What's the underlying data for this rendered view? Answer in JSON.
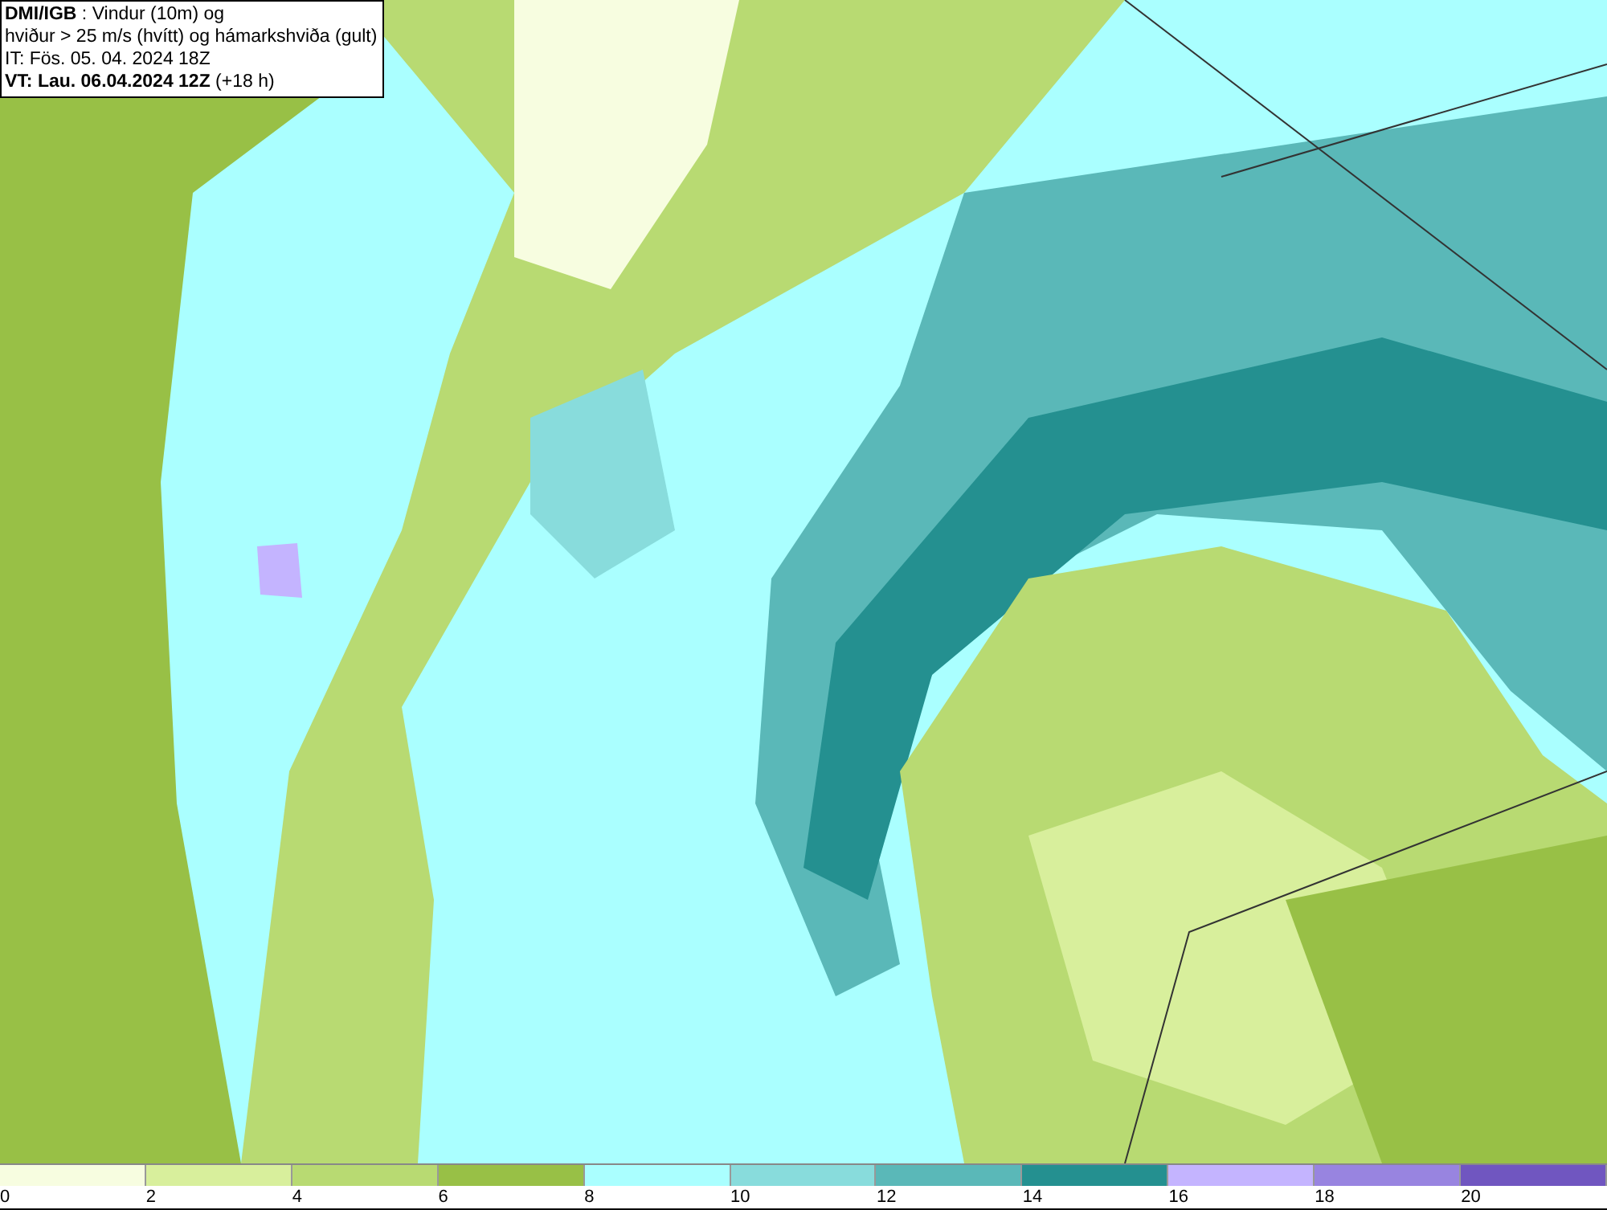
{
  "title_box": {
    "lines": [
      "**DMI/IGB** : Vindur (10m) og",
      "hviður > 25 m/s (hvítt) og hámarkshviða (gult)",
      "IT: Fös. 05. 04. 2024 18Z",
      "**VT: Lau. 06.04.2024 12Z** (+18 h)"
    ]
  },
  "legend": [
    {
      "label": "0",
      "color": "#f7fde0"
    },
    {
      "label": "2",
      "color": "#d8ef9c"
    },
    {
      "label": "4",
      "color": "#b8da72"
    },
    {
      "label": "6",
      "color": "#98c046"
    },
    {
      "label": "8",
      "color": "#aaffff"
    },
    {
      "label": "10",
      "color": "#88dcdc"
    },
    {
      "label": "12",
      "color": "#5ab8b8"
    },
    {
      "label": "14",
      "color": "#249090"
    },
    {
      "label": "16",
      "color": "#c4b4ff"
    },
    {
      "label": "18",
      "color": "#9884e0"
    },
    {
      "label": "20",
      "color": "#7056c0"
    }
  ]
}
